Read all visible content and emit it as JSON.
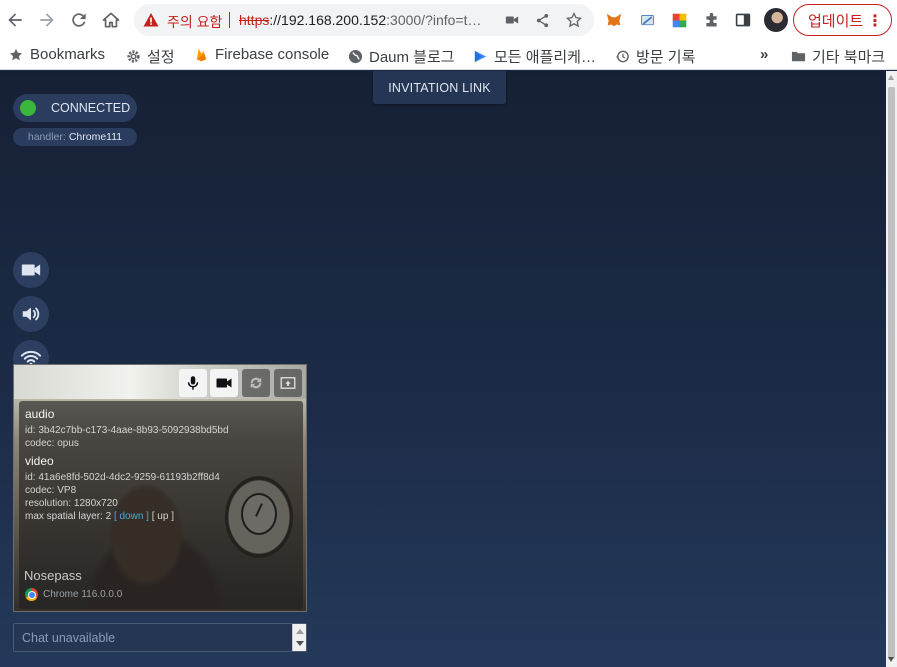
{
  "browser": {
    "nav": {
      "back_icon": "arrow-left-icon",
      "forward_icon": "arrow-right-icon",
      "reload_icon": "reload-icon",
      "home_icon": "home-icon"
    },
    "security_warning": "주의 요함",
    "url_scheme": "https",
    "url_host": "://192.168.200.152",
    "url_rest": ":3000/?info=t…",
    "update_label": "업데이트",
    "update_menu_icon": "⋮",
    "bookmarks": [
      {
        "label": "Bookmarks",
        "icon": "star-icon"
      },
      {
        "label": "설정",
        "icon": "gear-icon"
      },
      {
        "label": "Firebase console",
        "icon": "firebase-icon"
      },
      {
        "label": "Daum 블로그",
        "icon": "globe-icon"
      },
      {
        "label": "모든 애플리케…",
        "icon": "apps-icon"
      },
      {
        "label": "방문 기록",
        "icon": "history-icon"
      }
    ],
    "bookmarks_overflow": "»",
    "other_bookmarks": "기타 북마크"
  },
  "page": {
    "invitation_label": "INVITATION LINK",
    "connection_status": "CONNECTED",
    "status_color": "#3bb83b",
    "handler_label": "handler:",
    "handler_value": "Chrome111",
    "side_buttons": [
      "camera-icon",
      "speaker-icon",
      "wifi-icon"
    ],
    "peer": {
      "controls": [
        "mic-icon",
        "camera-icon",
        "restart-ice-icon",
        "screen-share-icon"
      ],
      "audio_heading": "audio",
      "audio_id": "id: 3b42c7bb-c173-4aae-8b93-5092938bd5bd",
      "audio_codec": "codec: opus",
      "video_heading": "video",
      "video_id": "id: 41a6e8fd-502d-4dc2-9259-61193b2ff8d4",
      "video_codec": "codec: VP8",
      "video_resolution": "resolution: 1280x720",
      "spatial_label": "max spatial layer: 2",
      "spatial_down": "[ down ]",
      "spatial_up": "[ up ]",
      "name": "Nosepass",
      "browser": "Chrome 116.0.0.0"
    },
    "chat_placeholder": "Chat unavailable"
  }
}
